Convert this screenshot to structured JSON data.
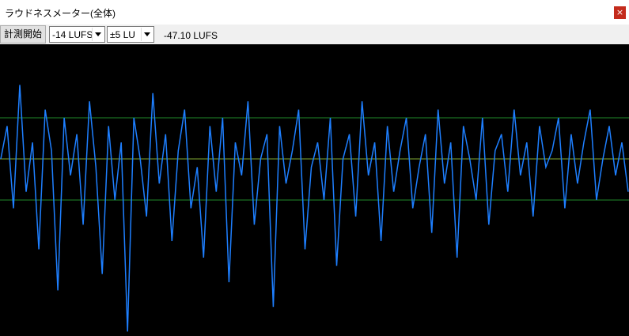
{
  "window": {
    "title": "ラウドネスメーター(全体)",
    "close_glyph": "×"
  },
  "toolbar": {
    "start_button_label": "計測開始",
    "target_select": {
      "selected": "-14 LUFS"
    },
    "range_select": {
      "selected": "±5 LU"
    },
    "readout": "-47.10 LUFS"
  },
  "colors": {
    "waveform": "#1e7fff",
    "target_line": "#7fa832",
    "range_line": "#1f8a2a",
    "plot_background": "#000000"
  },
  "meter": {
    "target_lufs": -14,
    "range_lu": 5,
    "samples": [
      -14,
      -10,
      -20,
      -5,
      -18,
      -12,
      -25,
      -8,
      -13,
      -30,
      -9,
      -16,
      -11,
      -22,
      -7,
      -15,
      -28,
      -10,
      -19,
      -12,
      -35,
      -9,
      -14,
      -21,
      -6,
      -17,
      -11,
      -24,
      -13,
      -8,
      -20,
      -15,
      -26,
      -10,
      -18,
      -9,
      -29,
      -12,
      -16,
      -7,
      -22,
      -14,
      -11,
      -32,
      -10,
      -17,
      -13,
      -8,
      -25,
      -15,
      -12,
      -19,
      -9,
      -27,
      -14,
      -11,
      -21,
      -7,
      -16,
      -12,
      -24,
      -10,
      -18,
      -13,
      -9,
      -20,
      -15,
      -11,
      -23,
      -8,
      -17,
      -12,
      -26,
      -10,
      -14,
      -19,
      -9,
      -22,
      -13,
      -11,
      -18,
      -8,
      -16,
      -12,
      -21,
      -10,
      -15,
      -13,
      -9,
      -20,
      -11,
      -17,
      -12,
      -8,
      -19,
      -14,
      -10,
      -16,
      -12,
      -18
    ]
  }
}
